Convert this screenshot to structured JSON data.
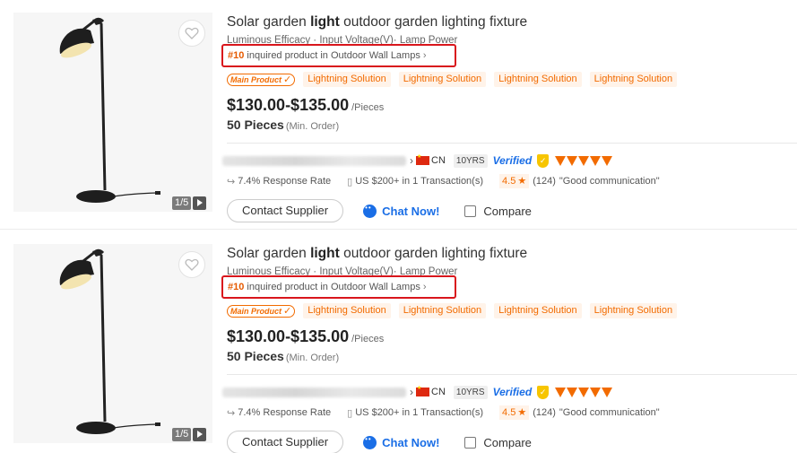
{
  "listings": [
    {
      "title_pre": "Solar garden ",
      "title_bold": "light",
      "title_post": " outdoor garden lighting fixture",
      "attributes": "Luminous Efficacy · Input Voltage(V)· Lamp Power",
      "rank_no": "#10",
      "rank_text": " inquired product in Outdoor Wall Lamps",
      "main_product_label": "Main Product",
      "tags": [
        "Lightning Solution",
        "Lightning Solution",
        "Lightning Solution",
        "Lightning Solution"
      ],
      "price": "$130.00-$135.00",
      "price_unit": "/Pieces",
      "moq_qty": "50 Pieces",
      "moq_label": "(Min. Order)",
      "country": "CN",
      "years": "10YRS",
      "verified": "Verified",
      "response_rate": "7.4% Response Rate",
      "transactions": "US $200+ in 1 Transaction(s)",
      "rating": "4.5",
      "review_count": "(124)",
      "review_quote": "\"Good communication\"",
      "image_counter": "1/5",
      "contact_label": "Contact Supplier",
      "chat_label": "Chat Now!",
      "compare_label": "Compare"
    },
    {
      "title_pre": "Solar garden ",
      "title_bold": "light",
      "title_post": " outdoor garden lighting fixture",
      "attributes": "Luminous Efficacy · Input Voltage(V)· Lamp Power",
      "rank_no": "#10",
      "rank_text": " inquired product in Outdoor Wall Lamps",
      "main_product_label": "Main Product",
      "tags": [
        "Lightning Solution",
        "Lightning Solution",
        "Lightning Solution",
        "Lightning Solution"
      ],
      "price": "$130.00-$135.00",
      "price_unit": "/Pieces",
      "moq_qty": "50 Pieces",
      "moq_label": "(Min. Order)",
      "country": "CN",
      "years": "10YRS",
      "verified": "Verified",
      "response_rate": "7.4% Response Rate",
      "transactions": "US $200+ in 1 Transaction(s)",
      "rating": "4.5",
      "review_count": "(124)",
      "review_quote": "\"Good communication\"",
      "image_counter": "1/5",
      "contact_label": "Contact Supplier",
      "chat_label": "Chat Now!",
      "compare_label": "Compare"
    }
  ],
  "icons": {
    "heart": "heart-outline-icon",
    "play": "play-icon",
    "chevron": "chevron-right-icon",
    "flag": "china-flag-icon",
    "shield": "gold-supplier-shield-icon",
    "diamond": "diamond-icon",
    "response": "reply-arrow-icon",
    "transaction": "document-icon",
    "star": "star-icon",
    "chat": "chat-bubble-icon"
  },
  "colors": {
    "accent_orange": "#f26b00",
    "highlight_red": "#d9161c",
    "link_blue": "#1a6ee6"
  }
}
